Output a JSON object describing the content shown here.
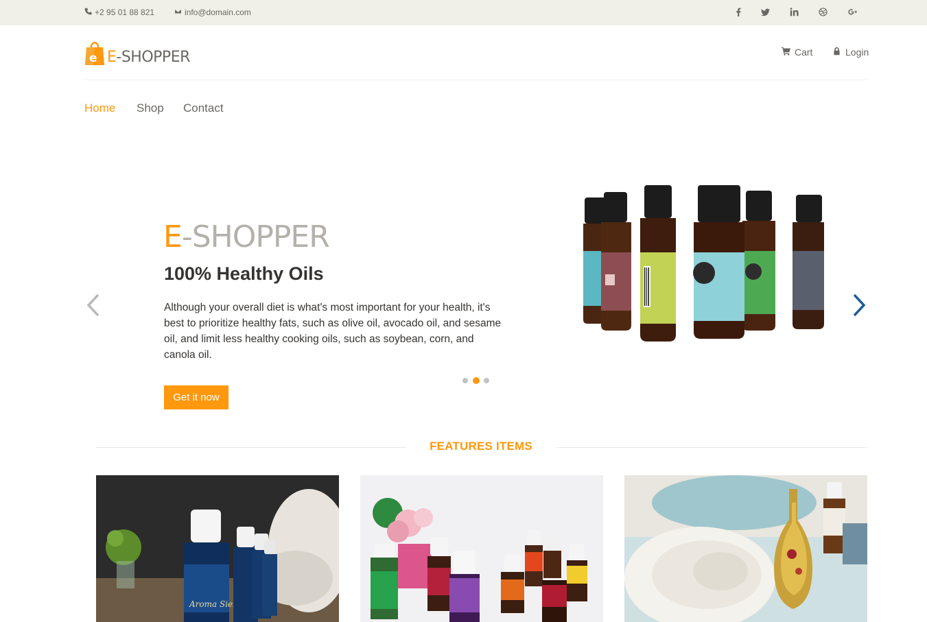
{
  "topbar": {
    "phone": "+2 95 01 88 821",
    "email": "info@domain.com",
    "social": [
      "facebook-icon",
      "twitter-icon",
      "linkedin-icon",
      "dribbble-icon",
      "google-plus-icon"
    ]
  },
  "header": {
    "logo_e": "E",
    "logo_rest": "-SHOPPER",
    "cart_label": "Cart",
    "login_label": "Login"
  },
  "nav": {
    "items": [
      {
        "label": "Home",
        "active": true
      },
      {
        "label": "Shop",
        "active": false
      },
      {
        "label": "Contact",
        "active": false
      }
    ]
  },
  "slider": {
    "brand_e": "E",
    "brand_rest": "-SHOPPER",
    "title": "100% Healthy Oils",
    "description": "Although your overall diet is what's most important for your health, it's best to prioritize healthy fats, such as olive oil, avocado oil, and sesame oil, and limit less healthy cooking oils, such as soybean, corn, and canola oil.",
    "button_label": "Get it now",
    "dots": 3,
    "active_dot": 2
  },
  "features": {
    "title": "FEATURES ITEMS"
  },
  "colors": {
    "accent": "#FE980F",
    "topbar_bg": "#f0f0e9",
    "text_muted": "#696763",
    "arrow_blue": "#1f5c99"
  }
}
